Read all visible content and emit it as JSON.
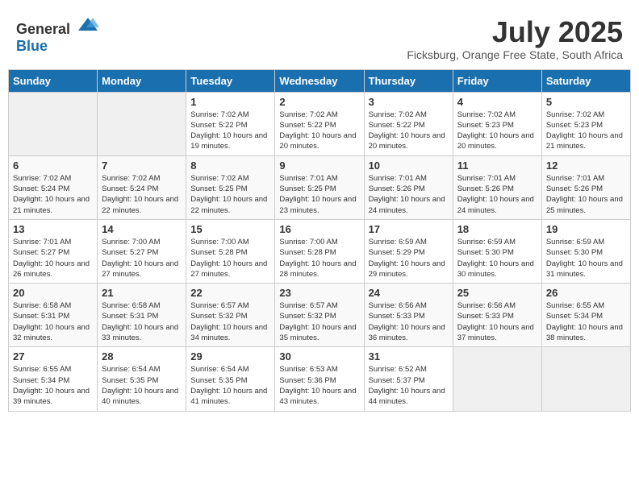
{
  "header": {
    "logo_general": "General",
    "logo_blue": "Blue",
    "month_year": "July 2025",
    "location": "Ficksburg, Orange Free State, South Africa"
  },
  "days_of_week": [
    "Sunday",
    "Monday",
    "Tuesday",
    "Wednesday",
    "Thursday",
    "Friday",
    "Saturday"
  ],
  "weeks": [
    [
      {
        "num": "",
        "sunrise": "",
        "sunset": "",
        "daylight": "",
        "empty": true
      },
      {
        "num": "",
        "sunrise": "",
        "sunset": "",
        "daylight": "",
        "empty": true
      },
      {
        "num": "1",
        "sunrise": "Sunrise: 7:02 AM",
        "sunset": "Sunset: 5:22 PM",
        "daylight": "Daylight: 10 hours and 19 minutes."
      },
      {
        "num": "2",
        "sunrise": "Sunrise: 7:02 AM",
        "sunset": "Sunset: 5:22 PM",
        "daylight": "Daylight: 10 hours and 20 minutes."
      },
      {
        "num": "3",
        "sunrise": "Sunrise: 7:02 AM",
        "sunset": "Sunset: 5:22 PM",
        "daylight": "Daylight: 10 hours and 20 minutes."
      },
      {
        "num": "4",
        "sunrise": "Sunrise: 7:02 AM",
        "sunset": "Sunset: 5:23 PM",
        "daylight": "Daylight: 10 hours and 20 minutes."
      },
      {
        "num": "5",
        "sunrise": "Sunrise: 7:02 AM",
        "sunset": "Sunset: 5:23 PM",
        "daylight": "Daylight: 10 hours and 21 minutes."
      }
    ],
    [
      {
        "num": "6",
        "sunrise": "Sunrise: 7:02 AM",
        "sunset": "Sunset: 5:24 PM",
        "daylight": "Daylight: 10 hours and 21 minutes."
      },
      {
        "num": "7",
        "sunrise": "Sunrise: 7:02 AM",
        "sunset": "Sunset: 5:24 PM",
        "daylight": "Daylight: 10 hours and 22 minutes."
      },
      {
        "num": "8",
        "sunrise": "Sunrise: 7:02 AM",
        "sunset": "Sunset: 5:25 PM",
        "daylight": "Daylight: 10 hours and 22 minutes."
      },
      {
        "num": "9",
        "sunrise": "Sunrise: 7:01 AM",
        "sunset": "Sunset: 5:25 PM",
        "daylight": "Daylight: 10 hours and 23 minutes."
      },
      {
        "num": "10",
        "sunrise": "Sunrise: 7:01 AM",
        "sunset": "Sunset: 5:26 PM",
        "daylight": "Daylight: 10 hours and 24 minutes."
      },
      {
        "num": "11",
        "sunrise": "Sunrise: 7:01 AM",
        "sunset": "Sunset: 5:26 PM",
        "daylight": "Daylight: 10 hours and 24 minutes."
      },
      {
        "num": "12",
        "sunrise": "Sunrise: 7:01 AM",
        "sunset": "Sunset: 5:26 PM",
        "daylight": "Daylight: 10 hours and 25 minutes."
      }
    ],
    [
      {
        "num": "13",
        "sunrise": "Sunrise: 7:01 AM",
        "sunset": "Sunset: 5:27 PM",
        "daylight": "Daylight: 10 hours and 26 minutes."
      },
      {
        "num": "14",
        "sunrise": "Sunrise: 7:00 AM",
        "sunset": "Sunset: 5:27 PM",
        "daylight": "Daylight: 10 hours and 27 minutes."
      },
      {
        "num": "15",
        "sunrise": "Sunrise: 7:00 AM",
        "sunset": "Sunset: 5:28 PM",
        "daylight": "Daylight: 10 hours and 27 minutes."
      },
      {
        "num": "16",
        "sunrise": "Sunrise: 7:00 AM",
        "sunset": "Sunset: 5:28 PM",
        "daylight": "Daylight: 10 hours and 28 minutes."
      },
      {
        "num": "17",
        "sunrise": "Sunrise: 6:59 AM",
        "sunset": "Sunset: 5:29 PM",
        "daylight": "Daylight: 10 hours and 29 minutes."
      },
      {
        "num": "18",
        "sunrise": "Sunrise: 6:59 AM",
        "sunset": "Sunset: 5:30 PM",
        "daylight": "Daylight: 10 hours and 30 minutes."
      },
      {
        "num": "19",
        "sunrise": "Sunrise: 6:59 AM",
        "sunset": "Sunset: 5:30 PM",
        "daylight": "Daylight: 10 hours and 31 minutes."
      }
    ],
    [
      {
        "num": "20",
        "sunrise": "Sunrise: 6:58 AM",
        "sunset": "Sunset: 5:31 PM",
        "daylight": "Daylight: 10 hours and 32 minutes."
      },
      {
        "num": "21",
        "sunrise": "Sunrise: 6:58 AM",
        "sunset": "Sunset: 5:31 PM",
        "daylight": "Daylight: 10 hours and 33 minutes."
      },
      {
        "num": "22",
        "sunrise": "Sunrise: 6:57 AM",
        "sunset": "Sunset: 5:32 PM",
        "daylight": "Daylight: 10 hours and 34 minutes."
      },
      {
        "num": "23",
        "sunrise": "Sunrise: 6:57 AM",
        "sunset": "Sunset: 5:32 PM",
        "daylight": "Daylight: 10 hours and 35 minutes."
      },
      {
        "num": "24",
        "sunrise": "Sunrise: 6:56 AM",
        "sunset": "Sunset: 5:33 PM",
        "daylight": "Daylight: 10 hours and 36 minutes."
      },
      {
        "num": "25",
        "sunrise": "Sunrise: 6:56 AM",
        "sunset": "Sunset: 5:33 PM",
        "daylight": "Daylight: 10 hours and 37 minutes."
      },
      {
        "num": "26",
        "sunrise": "Sunrise: 6:55 AM",
        "sunset": "Sunset: 5:34 PM",
        "daylight": "Daylight: 10 hours and 38 minutes."
      }
    ],
    [
      {
        "num": "27",
        "sunrise": "Sunrise: 6:55 AM",
        "sunset": "Sunset: 5:34 PM",
        "daylight": "Daylight: 10 hours and 39 minutes."
      },
      {
        "num": "28",
        "sunrise": "Sunrise: 6:54 AM",
        "sunset": "Sunset: 5:35 PM",
        "daylight": "Daylight: 10 hours and 40 minutes."
      },
      {
        "num": "29",
        "sunrise": "Sunrise: 6:54 AM",
        "sunset": "Sunset: 5:35 PM",
        "daylight": "Daylight: 10 hours and 41 minutes."
      },
      {
        "num": "30",
        "sunrise": "Sunrise: 6:53 AM",
        "sunset": "Sunset: 5:36 PM",
        "daylight": "Daylight: 10 hours and 43 minutes."
      },
      {
        "num": "31",
        "sunrise": "Sunrise: 6:52 AM",
        "sunset": "Sunset: 5:37 PM",
        "daylight": "Daylight: 10 hours and 44 minutes."
      },
      {
        "num": "",
        "sunrise": "",
        "sunset": "",
        "daylight": "",
        "empty": true
      },
      {
        "num": "",
        "sunrise": "",
        "sunset": "",
        "daylight": "",
        "empty": true
      }
    ]
  ]
}
